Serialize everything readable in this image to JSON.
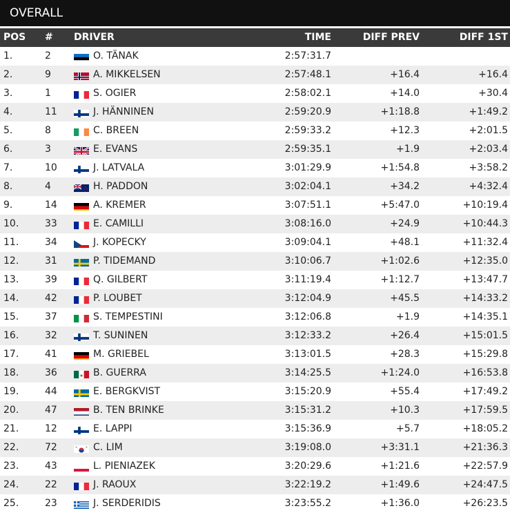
{
  "title": "OVERALL",
  "columns": {
    "pos": "POS",
    "num": "#",
    "driver": "DRIVER",
    "time": "TIME",
    "diff_prev": "DIFF PREV",
    "diff_1st": "DIFF 1ST"
  },
  "rows": [
    {
      "pos": "1.",
      "num": "2",
      "flag": "EST",
      "driver": "O. TÄNAK",
      "time": "2:57:31.7",
      "diff_prev": "",
      "diff_1st": ""
    },
    {
      "pos": "2.",
      "num": "9",
      "flag": "NOR",
      "driver": "A. MIKKELSEN",
      "time": "2:57:48.1",
      "diff_prev": "+16.4",
      "diff_1st": "+16.4"
    },
    {
      "pos": "3.",
      "num": "1",
      "flag": "FRA",
      "driver": "S. OGIER",
      "time": "2:58:02.1",
      "diff_prev": "+14.0",
      "diff_1st": "+30.4"
    },
    {
      "pos": "4.",
      "num": "11",
      "flag": "FIN",
      "driver": "J. HÄNNINEN",
      "time": "2:59:20.9",
      "diff_prev": "+1:18.8",
      "diff_1st": "+1:49.2"
    },
    {
      "pos": "5.",
      "num": "8",
      "flag": "IRL",
      "driver": "C. BREEN",
      "time": "2:59:33.2",
      "diff_prev": "+12.3",
      "diff_1st": "+2:01.5"
    },
    {
      "pos": "6.",
      "num": "3",
      "flag": "GBR",
      "driver": "E. EVANS",
      "time": "2:59:35.1",
      "diff_prev": "+1.9",
      "diff_1st": "+2:03.4"
    },
    {
      "pos": "7.",
      "num": "10",
      "flag": "FIN",
      "driver": "J. LATVALA",
      "time": "3:01:29.9",
      "diff_prev": "+1:54.8",
      "diff_1st": "+3:58.2"
    },
    {
      "pos": "8.",
      "num": "4",
      "flag": "NZL",
      "driver": "H. PADDON",
      "time": "3:02:04.1",
      "diff_prev": "+34.2",
      "diff_1st": "+4:32.4"
    },
    {
      "pos": "9.",
      "num": "14",
      "flag": "DEU",
      "driver": "A. KREMER",
      "time": "3:07:51.1",
      "diff_prev": "+5:47.0",
      "diff_1st": "+10:19.4"
    },
    {
      "pos": "10.",
      "num": "33",
      "flag": "FRA",
      "driver": "E. CAMILLI",
      "time": "3:08:16.0",
      "diff_prev": "+24.9",
      "diff_1st": "+10:44.3"
    },
    {
      "pos": "11.",
      "num": "34",
      "flag": "CZE",
      "driver": "J. KOPECKY",
      "time": "3:09:04.1",
      "diff_prev": "+48.1",
      "diff_1st": "+11:32.4"
    },
    {
      "pos": "12.",
      "num": "31",
      "flag": "SWE",
      "driver": "P. TIDEMAND",
      "time": "3:10:06.7",
      "diff_prev": "+1:02.6",
      "diff_1st": "+12:35.0"
    },
    {
      "pos": "13.",
      "num": "39",
      "flag": "FRA",
      "driver": "Q. GILBERT",
      "time": "3:11:19.4",
      "diff_prev": "+1:12.7",
      "diff_1st": "+13:47.7"
    },
    {
      "pos": "14.",
      "num": "42",
      "flag": "FRA",
      "driver": "P. LOUBET",
      "time": "3:12:04.9",
      "diff_prev": "+45.5",
      "diff_1st": "+14:33.2"
    },
    {
      "pos": "15.",
      "num": "37",
      "flag": "ITA",
      "driver": "S. TEMPESTINI",
      "time": "3:12:06.8",
      "diff_prev": "+1.9",
      "diff_1st": "+14:35.1"
    },
    {
      "pos": "16.",
      "num": "32",
      "flag": "FIN",
      "driver": "T. SUNINEN",
      "time": "3:12:33.2",
      "diff_prev": "+26.4",
      "diff_1st": "+15:01.5"
    },
    {
      "pos": "17.",
      "num": "41",
      "flag": "DEU",
      "driver": "M. GRIEBEL",
      "time": "3:13:01.5",
      "diff_prev": "+28.3",
      "diff_1st": "+15:29.8"
    },
    {
      "pos": "18.",
      "num": "36",
      "flag": "MEX",
      "driver": "B. GUERRA",
      "time": "3:14:25.5",
      "diff_prev": "+1:24.0",
      "diff_1st": "+16:53.8"
    },
    {
      "pos": "19.",
      "num": "44",
      "flag": "SWE",
      "driver": "E. BERGKVIST",
      "time": "3:15:20.9",
      "diff_prev": "+55.4",
      "diff_1st": "+17:49.2"
    },
    {
      "pos": "20.",
      "num": "47",
      "flag": "NLD",
      "driver": "B. TEN BRINKE",
      "time": "3:15:31.2",
      "diff_prev": "+10.3",
      "diff_1st": "+17:59.5"
    },
    {
      "pos": "21.",
      "num": "12",
      "flag": "FIN",
      "driver": "E. LAPPI",
      "time": "3:15:36.9",
      "diff_prev": "+5.7",
      "diff_1st": "+18:05.2"
    },
    {
      "pos": "22.",
      "num": "72",
      "flag": "KOR",
      "driver": "C. LIM",
      "time": "3:19:08.0",
      "diff_prev": "+3:31.1",
      "diff_1st": "+21:36.3"
    },
    {
      "pos": "23.",
      "num": "43",
      "flag": "POL",
      "driver": "L. PIENIAZEK",
      "time": "3:20:29.6",
      "diff_prev": "+1:21.6",
      "diff_1st": "+22:57.9"
    },
    {
      "pos": "24.",
      "num": "22",
      "flag": "FRA",
      "driver": "J. RAOUX",
      "time": "3:22:19.2",
      "diff_prev": "+1:49.6",
      "diff_1st": "+24:47.5"
    },
    {
      "pos": "25.",
      "num": "23",
      "flag": "GRC",
      "driver": "J. SERDERIDIS",
      "time": "3:23:55.2",
      "diff_prev": "+1:36.0",
      "diff_1st": "+26:23.5"
    }
  ]
}
